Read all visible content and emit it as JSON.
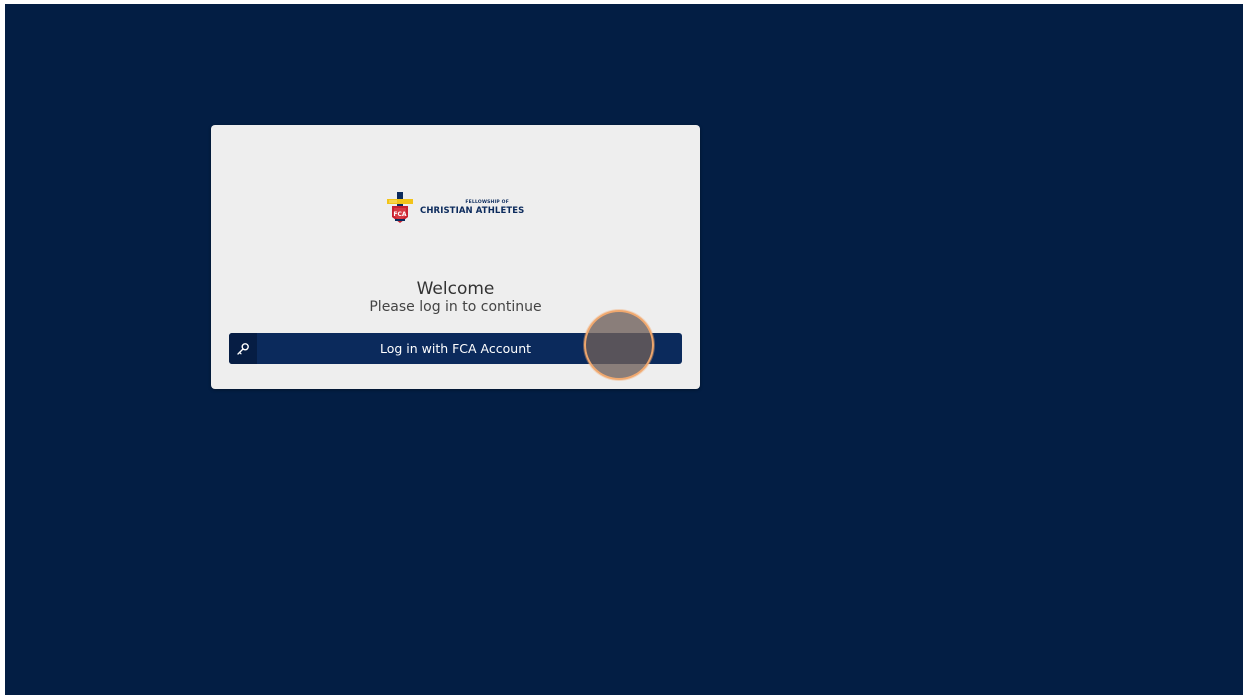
{
  "app": {
    "background_color": "#031e44",
    "card_color": "#eeeeee",
    "accent_color": "#0b2a5c"
  },
  "logo": {
    "icon": "fca-cross-logo-icon",
    "line1": "FELLOWSHIP OF",
    "line2": "CHRISTIAN ATHLETES",
    "badge": "FCA"
  },
  "login": {
    "welcome": "Welcome",
    "subtitle": "Please log in to continue",
    "button_label": "Log in with FCA Account",
    "button_icon": "key-icon"
  },
  "cursor": {
    "icon": "click-indicator-icon"
  }
}
